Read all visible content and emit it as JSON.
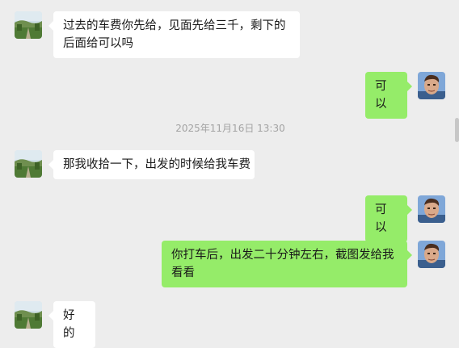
{
  "colors": {
    "background": "#ededed",
    "incoming_bubble": "#ffffff",
    "outgoing_bubble": "#95ec69",
    "timestamp_text": "#a3a3a3"
  },
  "icons": {
    "contact_avatar": "landscape-avatar-icon",
    "self_avatar": "person-avatar-icon"
  },
  "messages": [
    {
      "direction": "in",
      "text": "过去的车费你先给，见面先给三千，剩下的后面给可以吗"
    },
    {
      "direction": "out",
      "text": "可以"
    },
    {
      "direction": "in",
      "text": "那我收拾一下，出发的时候给我车费"
    },
    {
      "direction": "out",
      "text": "可以"
    },
    {
      "direction": "out",
      "text": "你打车后，出发二十分钟左右，截图发给我看看"
    },
    {
      "direction": "in",
      "text": "好的"
    }
  ],
  "timestamp": "2025年11月16日 13:30"
}
